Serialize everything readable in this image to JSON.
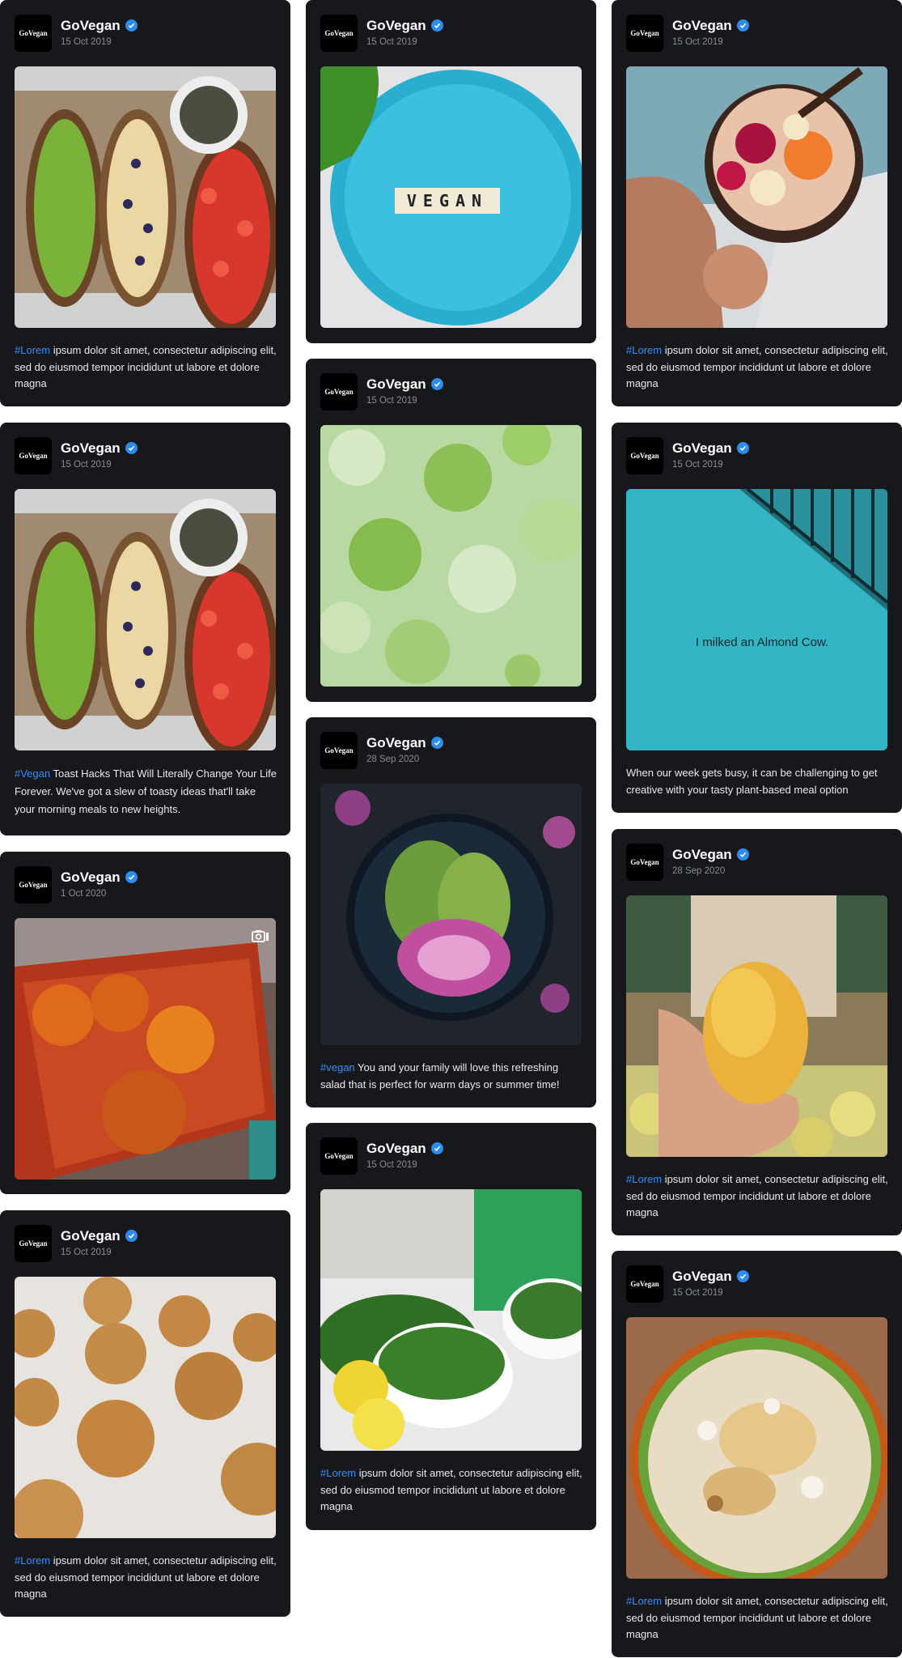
{
  "account": {
    "name": "GoVegan",
    "logo_text": "GoVegan",
    "verified_icon": "verified-check-icon"
  },
  "colors": {
    "card_bg": "#17181c",
    "hashtag": "#3a8ef5",
    "verified": "#2d8cf0"
  },
  "posts": [
    {
      "date": "15 Oct 2019",
      "hashtag": "#Lorem",
      "caption": " ipsum dolor sit amet, consectetur adipiscing elit, sed do eiusmod tempor incididunt ut labore et dolore magna"
    },
    {
      "date": "15 Oct 2019",
      "hashtag": "#Vegan",
      "caption": " Toast Hacks That Will Literally Change Your Life Forever. We've got a slew of toasty ideas that'll take your morning meals to new heights."
    },
    {
      "date": "1 Oct 2020"
    },
    {
      "date": "15 Oct 2019",
      "hashtag": "#Lorem",
      "caption": " ipsum dolor sit amet, consectetur adipiscing elit, sed do eiusmod tempor incididunt ut labore et dolore magna"
    },
    {
      "date": "15 Oct 2019",
      "photo_text": "VEGAN"
    },
    {
      "date": "15 Oct 2019"
    },
    {
      "date": "28 Sep 2020",
      "hashtag": "#vegan",
      "caption": " You and your family will love this refreshing salad that is perfect for warm days or summer time!"
    },
    {
      "date": "15 Oct 2019",
      "hashtag": "#Lorem",
      "caption": " ipsum dolor sit amet, consectetur adipiscing elit, sed do eiusmod tempor incididunt ut labore et dolore magna"
    },
    {
      "date": "15 Oct 2019",
      "hashtag": "#Lorem",
      "caption": " ipsum dolor sit amet, consectetur adipiscing elit, sed do eiusmod tempor incididunt ut labore et dolore magna"
    },
    {
      "date": "15 Oct 2019",
      "caption": "When our week gets busy, it can be challenging to get creative with your tasty plant-based meal option",
      "photo_text": "I milked an Almond Cow."
    },
    {
      "date": "28 Sep 2020",
      "hashtag": "#Lorem",
      "caption": " ipsum dolor sit amet, consectetur adipiscing elit, sed do eiusmod tempor incididunt ut labore et dolore magna"
    },
    {
      "date": "15 Oct 2019",
      "hashtag": "#Lorem",
      "caption": " ipsum dolor sit amet, consectetur adipiscing elit, sed do eiusmod tempor incididunt ut labore et dolore magna"
    }
  ],
  "icons": {
    "camera": "camera-icon"
  }
}
